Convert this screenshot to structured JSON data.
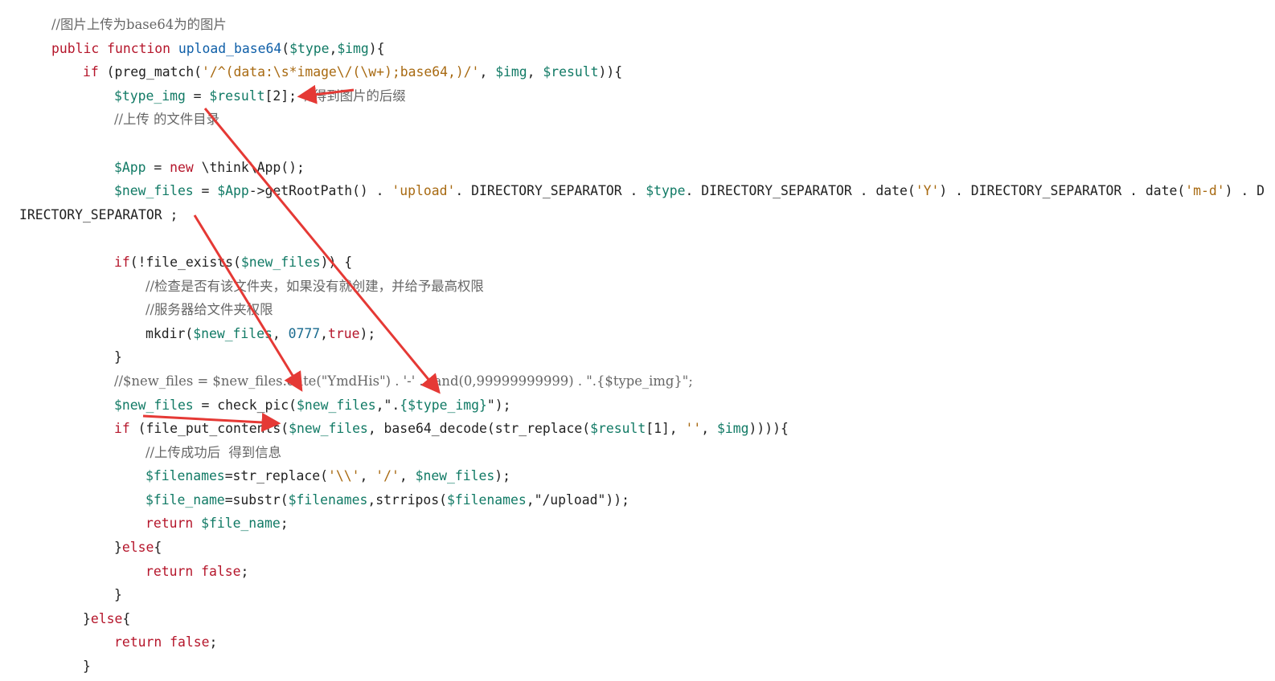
{
  "code": {
    "lines": [
      {
        "indent": 64,
        "tokens": [
          {
            "t": "com",
            "v": "//图片上传为base64为的图片"
          }
        ]
      },
      {
        "indent": 64,
        "tokens": [
          {
            "t": "kw",
            "v": "public"
          },
          {
            "t": "plain",
            "v": " "
          },
          {
            "t": "kw",
            "v": "function"
          },
          {
            "t": "plain",
            "v": " "
          },
          {
            "t": "fn",
            "v": "upload_base64"
          },
          {
            "t": "plain",
            "v": "("
          },
          {
            "t": "var",
            "v": "$type"
          },
          {
            "t": "plain",
            "v": ","
          },
          {
            "t": "var",
            "v": "$img"
          },
          {
            "t": "plain",
            "v": "){"
          }
        ]
      },
      {
        "indent": 103,
        "tokens": [
          {
            "t": "kw",
            "v": "if"
          },
          {
            "t": "plain",
            "v": " (preg_match("
          },
          {
            "t": "str",
            "v": "'/^(data:\\s*image\\/(\\w+);base64,)/'"
          },
          {
            "t": "plain",
            "v": ", "
          },
          {
            "t": "var",
            "v": "$img"
          },
          {
            "t": "plain",
            "v": ", "
          },
          {
            "t": "var",
            "v": "$result"
          },
          {
            "t": "plain",
            "v": ")){"
          }
        ]
      },
      {
        "indent": 142,
        "tokens": [
          {
            "t": "var",
            "v": "$type_img"
          },
          {
            "t": "plain",
            "v": " = "
          },
          {
            "t": "var",
            "v": "$result"
          },
          {
            "t": "plain",
            "v": "[2]; "
          },
          {
            "t": "com",
            "v": "//得到图片的后缀"
          }
        ]
      },
      {
        "indent": 142,
        "tokens": [
          {
            "t": "com",
            "v": "//上传 的文件目录"
          }
        ]
      },
      {
        "indent": 0,
        "tokens": []
      },
      {
        "indent": 142,
        "tokens": [
          {
            "t": "var",
            "v": "$App"
          },
          {
            "t": "plain",
            "v": " = "
          },
          {
            "t": "kw",
            "v": "new"
          },
          {
            "t": "plain",
            "v": " \\think\\App();"
          }
        ]
      },
      {
        "indent": 142,
        "tokens": [
          {
            "t": "var",
            "v": "$new_files"
          },
          {
            "t": "plain",
            "v": " = "
          },
          {
            "t": "var",
            "v": "$App"
          },
          {
            "t": "plain",
            "v": "->getRootPath() . "
          },
          {
            "t": "str",
            "v": "'upload'"
          },
          {
            "t": "plain",
            "v": ". DIRECTORY_SEPARATOR . "
          },
          {
            "t": "var",
            "v": "$type"
          },
          {
            "t": "plain",
            "v": ". DIRECTORY_SEPARATOR . date("
          },
          {
            "t": "str",
            "v": "'Y'"
          },
          {
            "t": "plain",
            "v": ") . DIRECTORY_SEPARATOR . date("
          },
          {
            "t": "str",
            "v": "'m-d'"
          },
          {
            "t": "plain",
            "v": ") . D"
          }
        ]
      },
      {
        "indent": 24,
        "tokens": [
          {
            "t": "plain",
            "v": "IRECTORY_SEPARATOR ;"
          }
        ]
      },
      {
        "indent": 0,
        "tokens": []
      },
      {
        "indent": 142,
        "tokens": [
          {
            "t": "kw",
            "v": "if"
          },
          {
            "t": "plain",
            "v": "(!file_exists("
          },
          {
            "t": "var",
            "v": "$new_files"
          },
          {
            "t": "plain",
            "v": ")) {"
          }
        ]
      },
      {
        "indent": 181,
        "tokens": [
          {
            "t": "com",
            "v": "//检查是否有该文件夹，如果没有就创建，并给予最高权限"
          }
        ]
      },
      {
        "indent": 181,
        "tokens": [
          {
            "t": "com",
            "v": "//服务器给文件夹权限"
          }
        ]
      },
      {
        "indent": 181,
        "tokens": [
          {
            "t": "plain",
            "v": "mkdir("
          },
          {
            "t": "var",
            "v": "$new_files"
          },
          {
            "t": "plain",
            "v": ", "
          },
          {
            "t": "num",
            "v": "0777"
          },
          {
            "t": "plain",
            "v": ","
          },
          {
            "t": "kw",
            "v": "true"
          },
          {
            "t": "plain",
            "v": ");"
          }
        ]
      },
      {
        "indent": 142,
        "tokens": [
          {
            "t": "plain",
            "v": "}"
          }
        ]
      },
      {
        "indent": 142,
        "tokens": [
          {
            "t": "com",
            "v": "//$new_files = $new_files.date(\"YmdHis\") . '-' . rand(0,99999999999) . \".{$type_img}\";"
          }
        ]
      },
      {
        "indent": 142,
        "tokens": [
          {
            "t": "var",
            "v": "$new_files"
          },
          {
            "t": "plain",
            "v": " = check_pic("
          },
          {
            "t": "var",
            "v": "$new_files"
          },
          {
            "t": "plain",
            "v": ",\"."
          },
          {
            "t": "var",
            "v": "{$type_img}"
          },
          {
            "t": "plain",
            "v": "\");"
          }
        ]
      },
      {
        "indent": 142,
        "tokens": [
          {
            "t": "kw",
            "v": "if"
          },
          {
            "t": "plain",
            "v": " (file_put_contents("
          },
          {
            "t": "var",
            "v": "$new_files"
          },
          {
            "t": "plain",
            "v": ", base64_decode(str_replace("
          },
          {
            "t": "var",
            "v": "$result"
          },
          {
            "t": "plain",
            "v": "[1], "
          },
          {
            "t": "str",
            "v": "''"
          },
          {
            "t": "plain",
            "v": ", "
          },
          {
            "t": "var",
            "v": "$img"
          },
          {
            "t": "plain",
            "v": ")))){"
          }
        ]
      },
      {
        "indent": 181,
        "tokens": [
          {
            "t": "com",
            "v": "//上传成功后  得到信息"
          }
        ]
      },
      {
        "indent": 181,
        "tokens": [
          {
            "t": "var",
            "v": "$filenames"
          },
          {
            "t": "plain",
            "v": "=str_replace("
          },
          {
            "t": "str",
            "v": "'\\\\'"
          },
          {
            "t": "plain",
            "v": ", "
          },
          {
            "t": "str",
            "v": "'/'"
          },
          {
            "t": "plain",
            "v": ", "
          },
          {
            "t": "var",
            "v": "$new_files"
          },
          {
            "t": "plain",
            "v": ");"
          }
        ]
      },
      {
        "indent": 181,
        "tokens": [
          {
            "t": "var",
            "v": "$file_name"
          },
          {
            "t": "plain",
            "v": "=substr("
          },
          {
            "t": "var",
            "v": "$filenames"
          },
          {
            "t": "plain",
            "v": ",strripos("
          },
          {
            "t": "var",
            "v": "$filenames"
          },
          {
            "t": "plain",
            "v": ",\"/upload\"));"
          }
        ]
      },
      {
        "indent": 181,
        "tokens": [
          {
            "t": "kw",
            "v": "return"
          },
          {
            "t": "plain",
            "v": " "
          },
          {
            "t": "var",
            "v": "$file_name"
          },
          {
            "t": "plain",
            "v": ";"
          }
        ]
      },
      {
        "indent": 142,
        "tokens": [
          {
            "t": "plain",
            "v": "}"
          },
          {
            "t": "kw",
            "v": "else"
          },
          {
            "t": "plain",
            "v": "{"
          }
        ]
      },
      {
        "indent": 181,
        "tokens": [
          {
            "t": "kw",
            "v": "return"
          },
          {
            "t": "plain",
            "v": " "
          },
          {
            "t": "kw",
            "v": "false"
          },
          {
            "t": "plain",
            "v": ";"
          }
        ]
      },
      {
        "indent": 142,
        "tokens": [
          {
            "t": "plain",
            "v": "}"
          }
        ]
      },
      {
        "indent": 103,
        "tokens": [
          {
            "t": "plain",
            "v": "}"
          },
          {
            "t": "kw",
            "v": "else"
          },
          {
            "t": "plain",
            "v": "{"
          }
        ]
      },
      {
        "indent": 142,
        "tokens": [
          {
            "t": "kw",
            "v": "return"
          },
          {
            "t": "plain",
            "v": " "
          },
          {
            "t": "kw",
            "v": "false"
          },
          {
            "t": "plain",
            "v": ";"
          }
        ]
      },
      {
        "indent": 103,
        "tokens": [
          {
            "t": "plain",
            "v": "}"
          }
        ]
      }
    ]
  },
  "colors": {
    "annotation_arrow": "#e53935"
  }
}
